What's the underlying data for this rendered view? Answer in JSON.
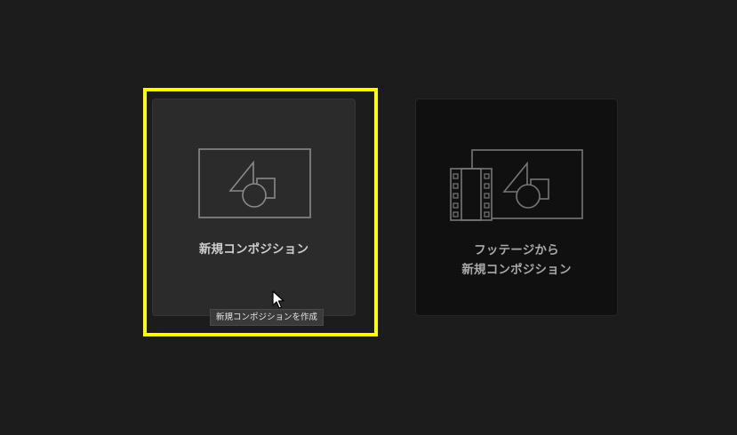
{
  "cards": [
    {
      "label": "新規コンポジション",
      "icon": "composition-icon"
    },
    {
      "label_line1": "フッテージから",
      "label_line2": "新規コンポジション",
      "icon": "footage-composition-icon"
    }
  ],
  "tooltip": {
    "text": "新規コンポジションを作成"
  },
  "colors": {
    "background": "#1c1c1c",
    "highlight": "#ffff00",
    "card_new": "#2b2b2b",
    "card_footage": "#101010"
  }
}
